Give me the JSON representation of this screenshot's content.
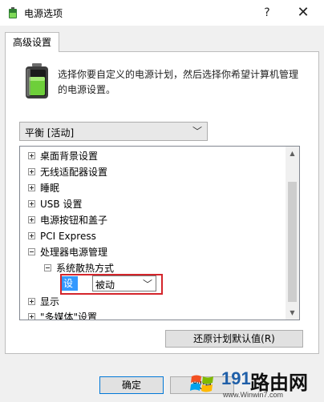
{
  "window": {
    "title": "电源选项",
    "help_glyph": "?",
    "close_glyph": "✕"
  },
  "tabs": [
    {
      "label": "高级设置"
    }
  ],
  "description": {
    "line1": "选择你要自定义的电源计划，然后选择你希望计算机管理",
    "line2": "的电源设置。"
  },
  "plan_select": {
    "value": "平衡 [活动]"
  },
  "tree": {
    "items": [
      {
        "label": "桌面背景设置",
        "state": "collapsed"
      },
      {
        "label": "无线适配器设置",
        "state": "collapsed"
      },
      {
        "label": "睡眠",
        "state": "collapsed"
      },
      {
        "label": "USB 设置",
        "state": "collapsed"
      },
      {
        "label": "电源按钮和盖子",
        "state": "collapsed"
      },
      {
        "label": "PCI Express",
        "state": "collapsed"
      },
      {
        "label": "处理器电源管理",
        "state": "expanded"
      },
      {
        "label": "系统散热方式",
        "state": "expanded"
      },
      {
        "label": "显示",
        "state": "collapsed"
      },
      {
        "label": "\"多媒体\"设置",
        "state": "collapsed"
      }
    ],
    "setting": {
      "label": "设置:",
      "value": "被动"
    }
  },
  "buttons": {
    "restore": "还原计划默认值(R)",
    "ok": "确定",
    "cancel": "取消"
  },
  "watermark": {
    "number": "191",
    "name": "路由网",
    "url": "www.Winwin7.com"
  },
  "colors": {
    "highlight": "#3399ff",
    "annotation": "#d4252b",
    "accent": "#0078d7"
  }
}
